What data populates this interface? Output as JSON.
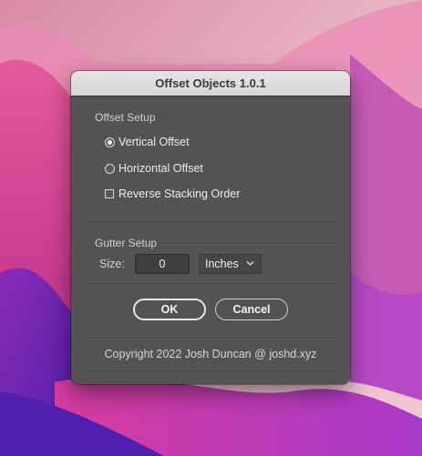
{
  "dialog": {
    "title": "Offset Objects 1.0.1"
  },
  "offset_setup": {
    "title": "Offset Setup",
    "options": [
      {
        "label": "Vertical Offset",
        "type": "radio",
        "selected": true
      },
      {
        "label": "Horizontal Offset",
        "type": "radio",
        "selected": false
      },
      {
        "label": "Reverse Stacking Order",
        "type": "checkbox",
        "checked": false
      }
    ]
  },
  "gutter_setup": {
    "title": "Gutter Setup",
    "size_label": "Size:",
    "size_value": "0",
    "units_selected": "Inches"
  },
  "buttons": {
    "ok": "OK",
    "cancel": "Cancel"
  },
  "footer": {
    "copyright": "Copyright 2022 Josh Duncan @ joshd.xyz"
  },
  "colors": {
    "dialog_bg": "#535353",
    "titlebar_bg": "#e0dddd",
    "wallpaper_magenta": "#c12f8f",
    "wallpaper_purple": "#5a1fb5"
  }
}
